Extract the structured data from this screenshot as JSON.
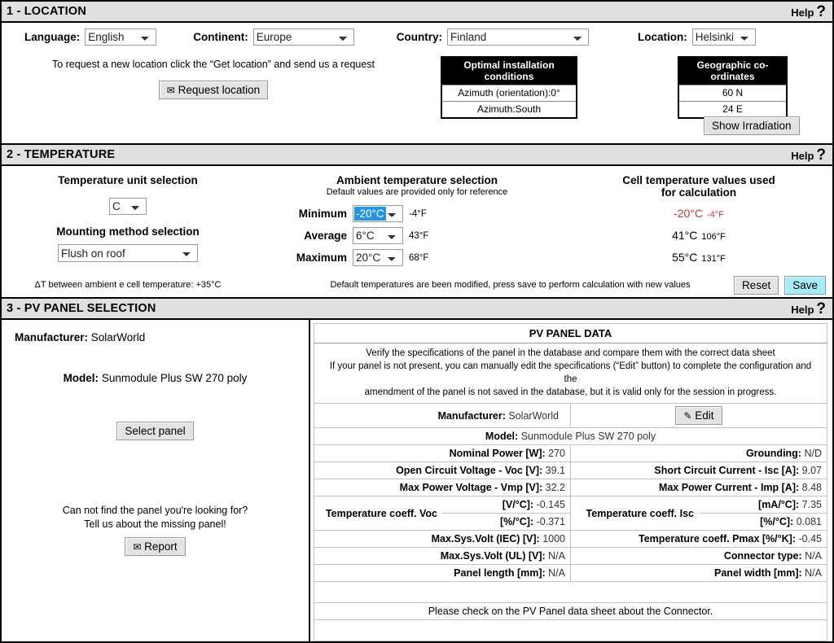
{
  "sections": {
    "location": {
      "title": "1 - LOCATION",
      "help_label": "Help",
      "help_icon": "question-mark-icon",
      "fields": [
        {
          "label": "Language:",
          "value": "English"
        },
        {
          "label": "Continent:",
          "value": "Europe"
        },
        {
          "label": "Country:",
          "value": "Finland"
        },
        {
          "label": "Location:",
          "value": "Helsinki"
        }
      ],
      "request_hint": "To request a new location click the “Get location” and send us a request",
      "request_button": "Request location",
      "request_button_icon": "envelope-icon",
      "optimal_table": {
        "header": "Optimal installation conditions",
        "rows": [
          "Azimuth (orientation):0°",
          "Azimuth:South"
        ]
      },
      "geo_table": {
        "header": "Geographic co-ordinates",
        "rows": [
          "60 N",
          "24 E"
        ]
      },
      "show_irradiation_button": "Show Irradiation"
    },
    "temperature": {
      "title": "2 - TEMPERATURE",
      "help_label": "Help",
      "unit_heading": "Temperature unit selection",
      "unit_value": "C",
      "mounting_heading": "Mounting method selection",
      "mounting_value": "Flush on roof",
      "delta_note": "ΔT between ambient e cell temperature: +35°C",
      "ambient_heading": "Ambient temperature selection",
      "ambient_sub": "Default values are provided only for reference",
      "ambient_rows": [
        {
          "label": "Minimum",
          "value": "-20°C",
          "fahrenheit": "-4°F",
          "highlighted": true
        },
        {
          "label": "Average",
          "value": "6°C",
          "fahrenheit": "43°F",
          "highlighted": false
        },
        {
          "label": "Maximum",
          "value": "20°C",
          "fahrenheit": "68°F",
          "highlighted": false
        }
      ],
      "cell_heading_line1": "Cell temperature values used",
      "cell_heading_line2": "for calculation",
      "cell_rows": [
        {
          "celsius": "-20°C",
          "fahrenheit": "-4°F",
          "color": "#cc3333"
        },
        {
          "celsius": "41°C",
          "fahrenheit": "106°F",
          "color": "#000000"
        },
        {
          "celsius": "55°C",
          "fahrenheit": "131°F",
          "color": "#000000"
        }
      ],
      "modified_note": "Default temperatures are been modified, press save to perform calculation with new values",
      "reset_button": "Reset",
      "save_button": "Save",
      "save_button_color": "#a6ecfb"
    },
    "pv_panel": {
      "title": "3 - PV PANEL SELECTION",
      "help_label": "Help",
      "left": {
        "manufacturer_label": "Manufacturer:",
        "manufacturer_value": "SolarWorld",
        "model_label": "Model:",
        "model_value": "Sunmodule Plus SW 270 poly",
        "select_panel_button": "Select panel",
        "missing_line1": "Can not find the panel you're looking for?",
        "missing_line2": "Tell us about the missing panel!",
        "report_button": "Report",
        "report_button_icon": "envelope-icon"
      },
      "data": {
        "title": "PV PANEL DATA",
        "note_line1": "Verify the specifications of the panel in the database and compare them with the correct data sheet",
        "note_line2": "If your panel is not present, you can manually edit the specifications (“Edit” button) to complete the configuration and the",
        "note_line3": "amendment of the panel is not saved in the database, but it is valid only for the session in progress.",
        "manufacturer_label": "Manufacturer:",
        "manufacturer_value": "SolarWorld",
        "edit_button": "Edit",
        "edit_button_icon": "pencil-square-icon",
        "model_label": "Model:",
        "model_value": "Sunmodule Plus SW 270 poly",
        "rows": [
          {
            "left_key": "Nominal Power [W]:",
            "left_val": "270",
            "right_key": "Grounding:",
            "right_val": "N/D"
          },
          {
            "left_key": "Open Circuit Voltage - Voc [V]:",
            "left_val": "39.1",
            "right_key": "Short Circuit Current - Isc [A]:",
            "right_val": "9.07"
          },
          {
            "left_key": "Max Power Voltage - Vmp [V]:",
            "left_val": "32.2",
            "right_key": "Max Power Current - Imp [A]:",
            "right_val": "8.48"
          }
        ],
        "coeff_left": {
          "name": "Temperature coeff. Voc",
          "v1_key": "[V/°C]:",
          "v1_val": "-0.145",
          "v2_key": "[%/°C]:",
          "v2_val": "-0.371"
        },
        "coeff_right": {
          "name": "Temperature coeff. Isc",
          "v1_key": "[mA/°C]:",
          "v1_val": "7.35",
          "v2_key": "[%/°C]:",
          "v2_val": "0.081"
        },
        "rows2": [
          {
            "left_key": "Max.Sys.Volt (IEC) [V]:",
            "left_val": "1000",
            "right_key": "Temperature coeff. Pmax [%/°K]:",
            "right_val": "-0.45"
          },
          {
            "left_key": "Max.Sys.Volt (UL) [V]:",
            "left_val": "N/A",
            "right_key": "Connector type:",
            "right_val": "N/A"
          },
          {
            "left_key": "Panel length [mm]:",
            "left_val": "N/A",
            "right_key": "Panel width [mm]:",
            "right_val": "N/A"
          }
        ],
        "connector_note": "Please check on the PV Panel data sheet about the Connector."
      }
    }
  }
}
